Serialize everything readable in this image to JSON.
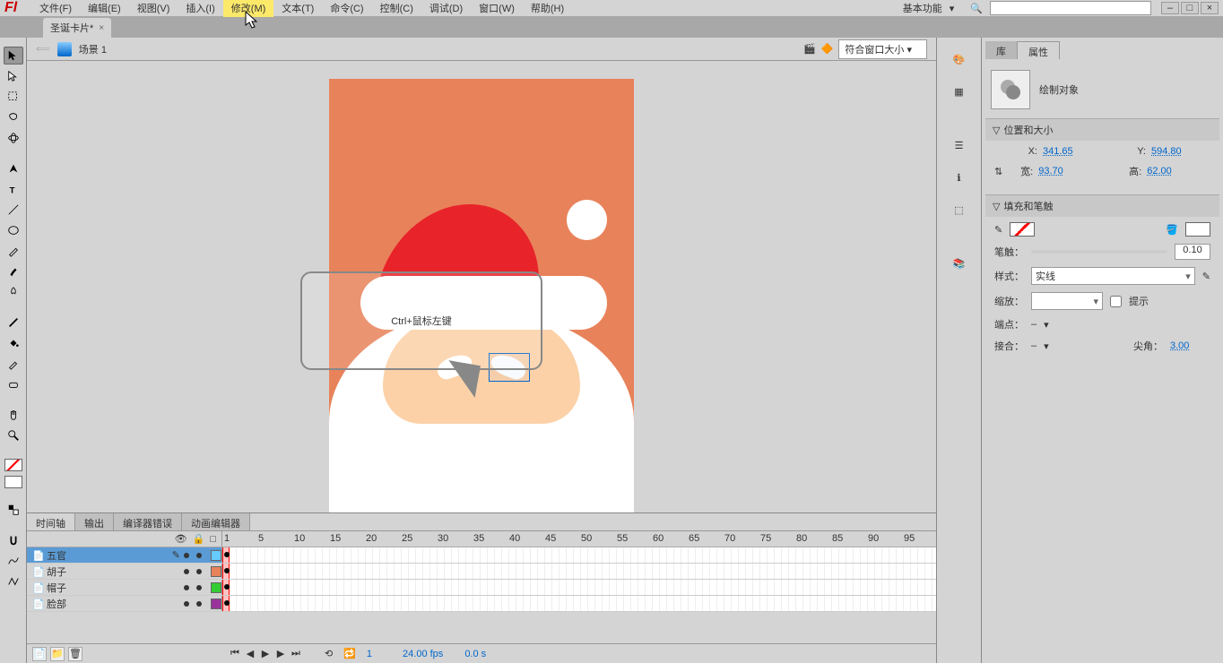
{
  "menu": {
    "file": "文件(F)",
    "edit": "编辑(E)",
    "view": "视图(V)",
    "insert": "插入(I)",
    "modify": "修改(M)",
    "text": "文本(T)",
    "command": "命令(C)",
    "control": "控制(C)",
    "debug": "调试(D)",
    "window": "窗口(W)",
    "help": "帮助(H)",
    "workspace": "基本功能"
  },
  "doc": {
    "tab_title": "圣诞卡片*"
  },
  "scene": {
    "label": "场景 1",
    "zoom": "符合窗口大小"
  },
  "callout": {
    "text": "Ctrl+鼠标左键"
  },
  "panels": {
    "timeline": "时间轴",
    "output": "输出",
    "compiler": "编译器错误",
    "motion": "动画编辑器"
  },
  "layers": [
    {
      "name": "五官",
      "selected": true,
      "color": "#6cf"
    },
    {
      "name": "胡子",
      "selected": false,
      "color": "#e8825a"
    },
    {
      "name": "帽子",
      "selected": false,
      "color": "#3c3"
    },
    {
      "name": "脸部",
      "selected": false,
      "color": "#939"
    }
  ],
  "frame_marks": [
    1,
    5,
    10,
    15,
    20,
    25,
    30,
    35,
    40,
    45,
    50,
    55,
    60,
    65,
    70,
    75,
    80,
    85,
    90,
    95
  ],
  "timeline_status": {
    "frame": "1",
    "fps": "24.00 fps",
    "time": "0.0 s"
  },
  "props": {
    "tab_lib": "库",
    "tab_props": "属性",
    "object_type": "绘制对象",
    "sec_pos": "位置和大小",
    "x_label": "X:",
    "x": "341.65",
    "y_label": "Y:",
    "y": "594.80",
    "w_label": "宽:",
    "w": "93.70",
    "h_label": "高:",
    "h": "62.00",
    "sec_fill": "填充和笔触",
    "stroke_label": "笔触：",
    "stroke_val": "0.10",
    "style_label": "样式：",
    "style_val": "实线",
    "scale_label": "缩放：",
    "hint": "提示",
    "cap_label": "端点：",
    "cap_val": "–",
    "join_label": "接合：",
    "join_val": "–",
    "miter_label": "尖角：",
    "miter_val": "3.00"
  }
}
